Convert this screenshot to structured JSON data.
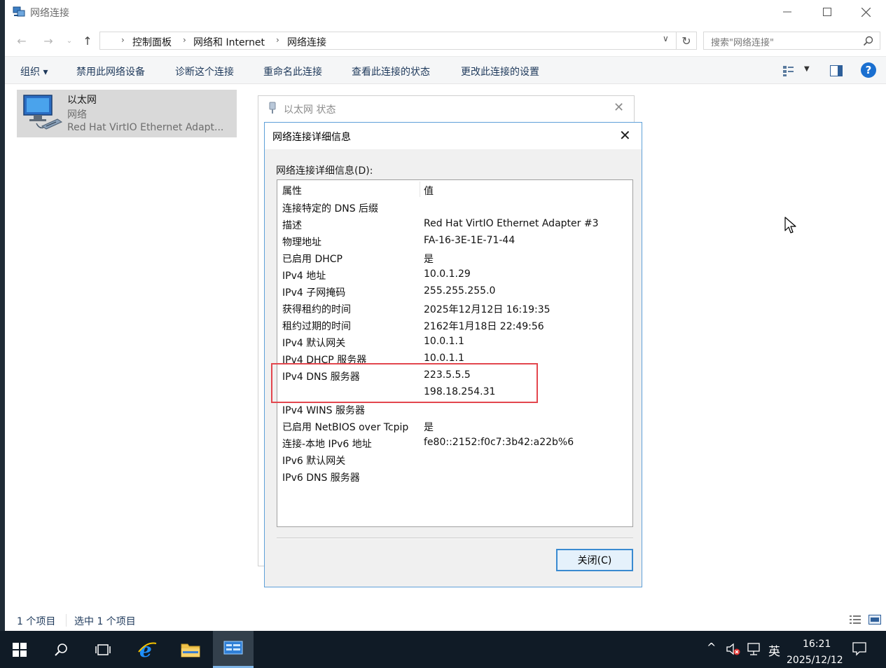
{
  "window": {
    "title": "网络连接",
    "minimize_icon": "minimize-icon",
    "maximize_icon": "maximize-icon",
    "close_icon": "close-icon"
  },
  "address": {
    "crumbs": [
      "控制面板",
      "网络和 Internet",
      "网络连接"
    ],
    "search_placeholder": "搜索\"网络连接\""
  },
  "commands": {
    "organize": "组织 ▾",
    "disable": "禁用此网络设备",
    "diagnose": "诊断这个连接",
    "rename": "重命名此连接",
    "view_status": "查看此连接的状态",
    "change_settings": "更改此连接的设置"
  },
  "adapter": {
    "name": "以太网",
    "type": "网络",
    "description": "Red Hat VirtIO Ethernet Adapt..."
  },
  "statusbar": {
    "count": "1 个项目",
    "selected": "选中 1 个项目"
  },
  "status_dialog": {
    "title": "以太网 状态"
  },
  "details_dialog": {
    "title": "网络连接详细信息",
    "label": "网络连接详细信息(D):",
    "header": {
      "property": "属性",
      "value": "值"
    },
    "rows": [
      {
        "property": "连接特定的 DNS 后缀",
        "value": ""
      },
      {
        "property": "描述",
        "value": "Red Hat VirtIO Ethernet Adapter #3"
      },
      {
        "property": "物理地址",
        "value": "FA-16-3E-1E-71-44"
      },
      {
        "property": "已启用 DHCP",
        "value": "是"
      },
      {
        "property": "IPv4 地址",
        "value": "10.0.1.29"
      },
      {
        "property": "IPv4 子网掩码",
        "value": "255.255.255.0"
      },
      {
        "property": "获得租约的时间",
        "value": "2025年12月12日 16:19:35"
      },
      {
        "property": "租约过期的时间",
        "value": "2162年1月18日 22:49:56"
      },
      {
        "property": "IPv4 默认网关",
        "value": "10.0.1.1"
      },
      {
        "property": "IPv4 DHCP 服务器",
        "value": "10.0.1.1"
      },
      {
        "property": "IPv4 DNS 服务器",
        "value": "223.5.5.5"
      },
      {
        "property": "",
        "value": "198.18.254.31"
      },
      {
        "property": "IPv4 WINS 服务器",
        "value": ""
      },
      {
        "property": "已启用 NetBIOS over Tcpip",
        "value": "是"
      },
      {
        "property": "连接-本地 IPv6 地址",
        "value": "fe80::2152:f0c7:3b42:a22b%6"
      },
      {
        "property": "IPv6 默认网关",
        "value": ""
      },
      {
        "property": "IPv6 DNS 服务器",
        "value": ""
      }
    ],
    "close_button": "关闭(C)"
  },
  "taskbar": {
    "ime": "英",
    "time": "16:21",
    "date": "2025/12/12"
  },
  "colors": {
    "accent": "#1a6fd0",
    "highlight_box": "#e3474e",
    "taskbar": "#101b26"
  }
}
